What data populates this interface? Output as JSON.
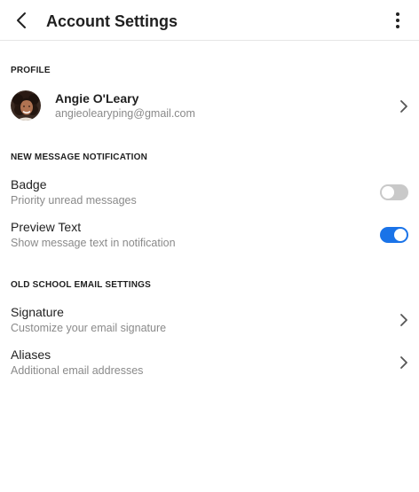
{
  "header": {
    "title": "Account Settings",
    "back_icon": "chevron-left-icon",
    "more_icon": "vertical-ellipsis-icon"
  },
  "profile": {
    "section_label": "PROFILE",
    "name": "Angie O'Leary",
    "email": "angieolearyping@gmail.com"
  },
  "notifications": {
    "section_label": "NEW MESSAGE NOTIFICATION",
    "badge": {
      "title": "Badge",
      "subtitle": "Priority unread messages",
      "enabled": false
    },
    "preview_text": {
      "title": "Preview Text",
      "subtitle": "Show message text in notification",
      "enabled": true
    }
  },
  "email_settings": {
    "section_label": "OLD SCHOOL EMAIL SETTINGS",
    "signature": {
      "title": "Signature",
      "subtitle": "Customize your email signature"
    },
    "aliases": {
      "title": "Aliases",
      "subtitle": "Additional email addresses"
    }
  },
  "colors": {
    "accent": "#1a73e8",
    "toggle_off": "#c9c9c9",
    "secondary_text": "#8a8a8a"
  }
}
